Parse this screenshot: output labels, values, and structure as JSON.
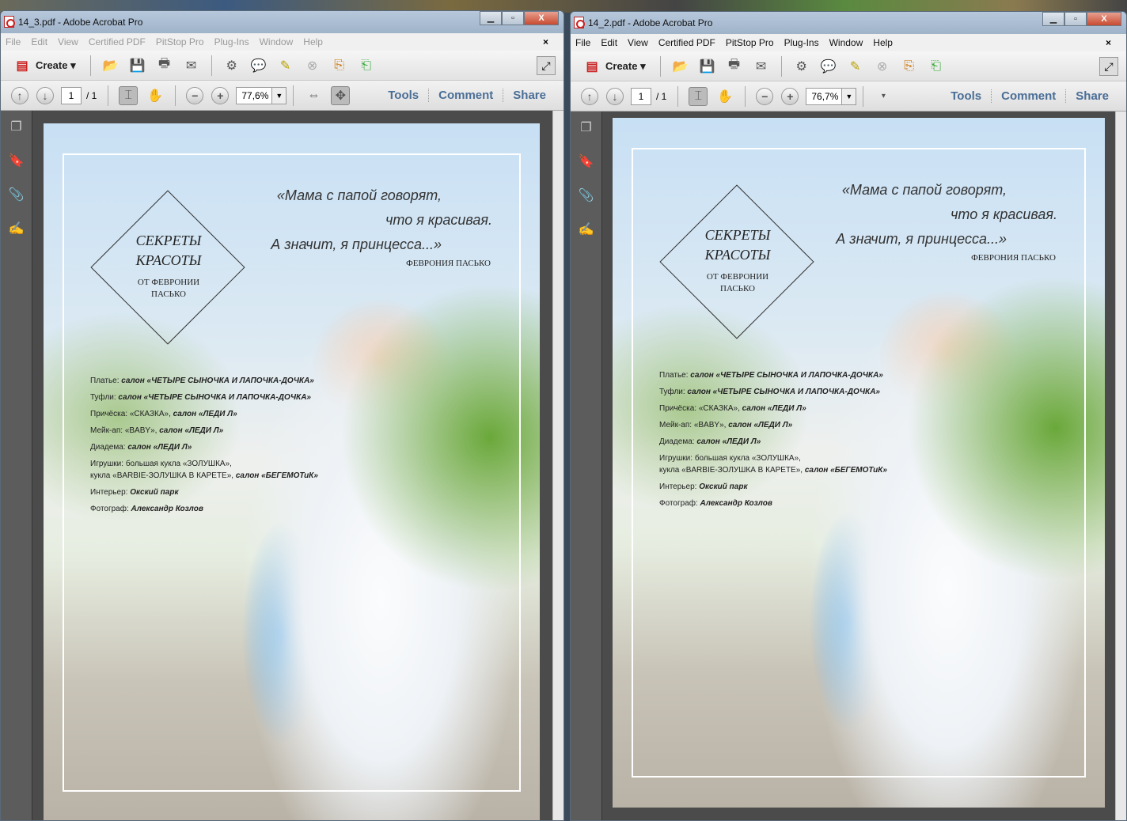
{
  "windows": [
    {
      "title": "14_3.pdf - Adobe Acrobat Pro",
      "zoom": "77,6%",
      "page": "1",
      "total": "/ 1",
      "dim": true
    },
    {
      "title": "14_2.pdf - Adobe Acrobat Pro",
      "zoom": "76,7%",
      "page": "1",
      "total": "/ 1",
      "dim": false
    }
  ],
  "menu": [
    "File",
    "Edit",
    "View",
    "Certified PDF",
    "PitStop Pro",
    "Plug-Ins",
    "Window",
    "Help"
  ],
  "create_label": "Create",
  "links": [
    "Tools",
    "Comment",
    "Share"
  ],
  "doc": {
    "diamond_title": [
      "СЕКРЕТЫ",
      "КРАСОТЫ"
    ],
    "diamond_sub": [
      "ОТ ФЕВРОНИИ",
      "ПАСЬКО"
    ],
    "quote": [
      "«Мама с папой говорят,",
      "что я красивая.",
      "А значит, я принцесса...»"
    ],
    "author": "ФЕВРОНИЯ ПАСЬКО",
    "credits": [
      {
        "label": "Платье: ",
        "value": "салон «ЧЕТЫРЕ СЫНОЧКА И ЛАПОЧКА-ДОЧКА»"
      },
      {
        "label": "Туфли: ",
        "value": "салон «ЧЕТЫРЕ СЫНОЧКА И ЛАПОЧКА-ДОЧКА»"
      },
      {
        "label": "Причёска: «СКАЗКА», ",
        "value": "салон «ЛЕДИ Л»"
      },
      {
        "label": "Мейк-ап: «BABY», ",
        "value": "салон «ЛЕДИ Л»"
      },
      {
        "label": "Диадема: ",
        "value": "салон «ЛЕДИ Л»"
      },
      {
        "label": "Игрушки: большая кукла «ЗОЛУШКА»,\nкукла «BARBIE-ЗОЛУШКА В КАРЕТЕ», ",
        "value": "салон «БЕГЕМОТиК»"
      },
      {
        "label": "Интерьер: ",
        "value": "Окский парк"
      },
      {
        "label": "Фотограф: ",
        "value": "Александр Козлов"
      }
    ]
  }
}
